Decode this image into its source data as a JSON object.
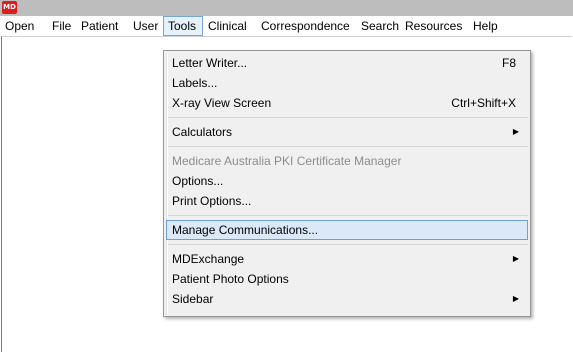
{
  "app": {
    "logo_text": "MD"
  },
  "menubar": {
    "items": [
      {
        "label": "Open"
      },
      {
        "label": "File"
      },
      {
        "label": "Patient"
      },
      {
        "label": "User"
      },
      {
        "label": "Tools",
        "active": true
      },
      {
        "label": "Clinical"
      },
      {
        "label": "Correspondence"
      },
      {
        "label": "Search"
      },
      {
        "label": "Resources"
      },
      {
        "label": "Help"
      }
    ]
  },
  "tools_menu": {
    "items": [
      {
        "label": "Letter Writer...",
        "shortcut": "F8"
      },
      {
        "label": "Labels..."
      },
      {
        "label": "X-ray View Screen",
        "shortcut": "Ctrl+Shift+X"
      },
      {
        "label": "Calculators",
        "submenu": true,
        "arrow": "▶"
      },
      {
        "label": "Medicare Australia PKI Certificate Manager",
        "disabled": true
      },
      {
        "label": "Options..."
      },
      {
        "label": "Print Options..."
      },
      {
        "label": "Manage Communications...",
        "highlighted": true
      },
      {
        "label": "MDExchange",
        "submenu": true,
        "arrow": "▶"
      },
      {
        "label": "Patient Photo Options"
      },
      {
        "label": "Sidebar",
        "submenu": true,
        "arrow": "▶"
      }
    ]
  }
}
